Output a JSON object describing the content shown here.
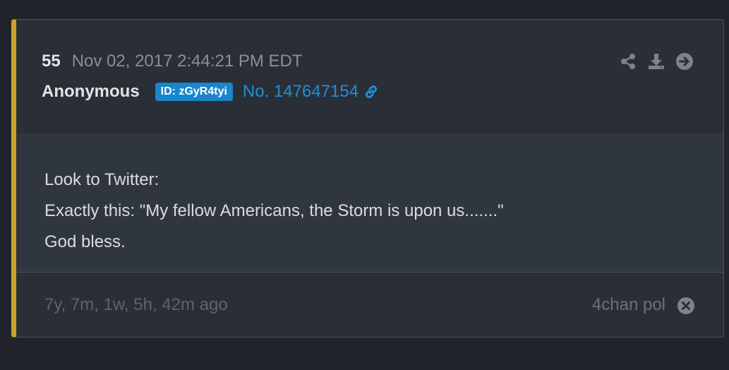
{
  "post": {
    "number": "55",
    "timestamp": "Nov 02, 2017 2:44:21 PM EDT",
    "author": "Anonymous",
    "id_badge": "ID: zGyR4tyi",
    "post_no": "No. 147647154",
    "message_lines": [
      "Look to Twitter:",
      "Exactly this: \"My fellow Americans, the Storm is upon us.......\"",
      "God bless."
    ],
    "age": "7y, 7m, 1w, 5h, 42m ago",
    "source": "4chan pol"
  },
  "icons": {
    "share": "share-icon",
    "download": "download-icon",
    "go": "arrow-right-circle-icon",
    "link": "link-icon",
    "close": "close-circle-icon"
  },
  "colors": {
    "accent_border": "#c9a22a",
    "id_badge_bg": "#1a86cc",
    "link": "#1e8fd6"
  }
}
